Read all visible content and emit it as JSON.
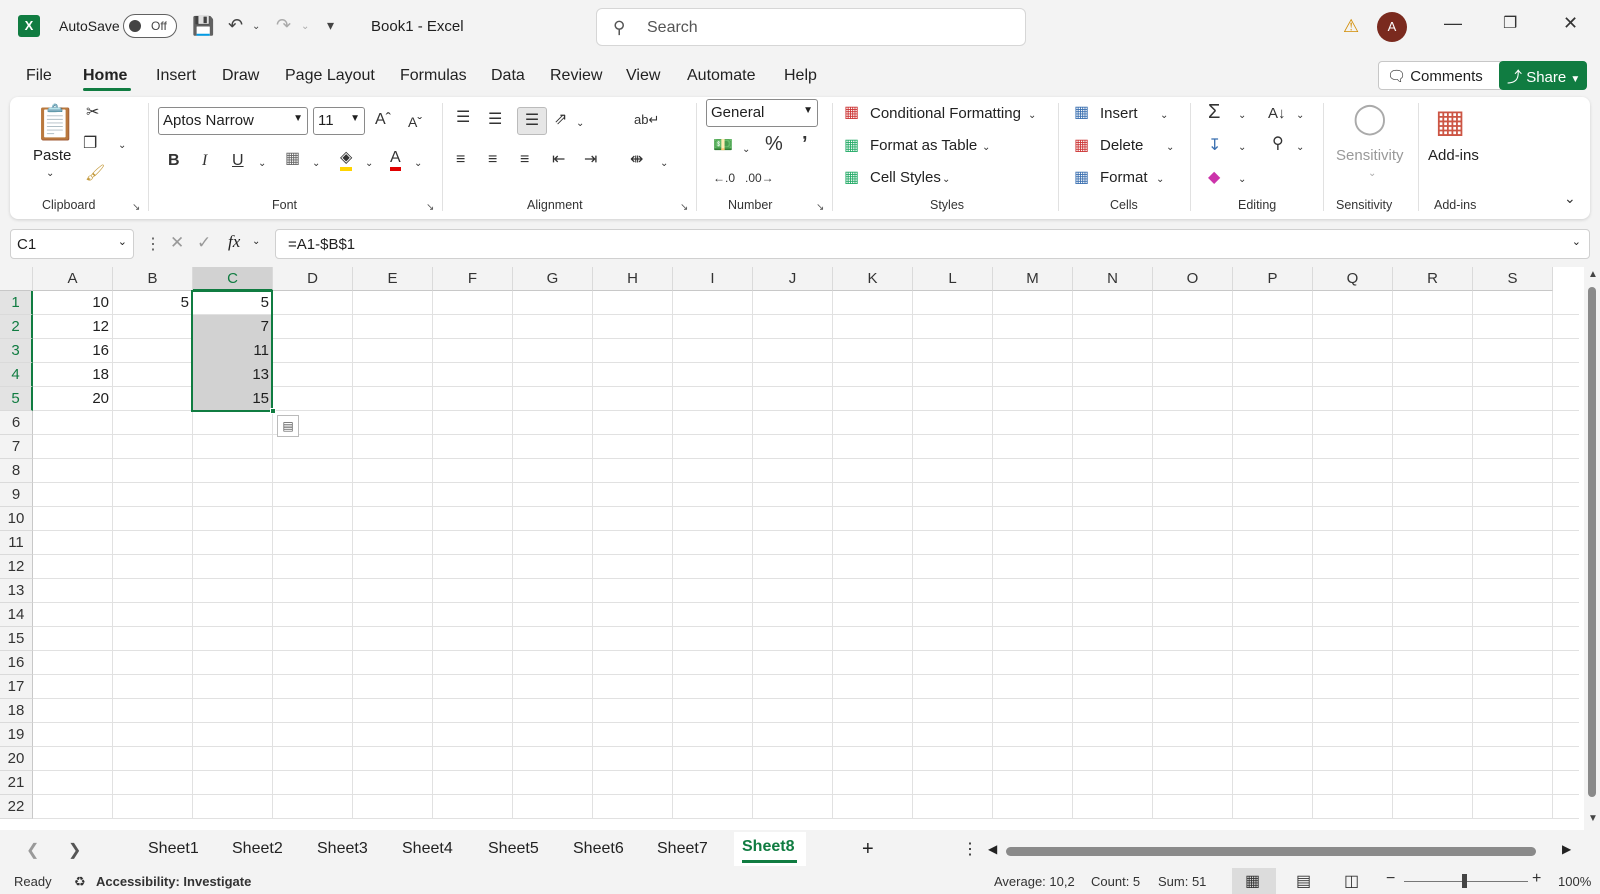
{
  "titlebar": {
    "app_icon": "X",
    "autosave_label": "AutoSave",
    "autosave_state": "Off",
    "doc_title": "Book1  -  Excel",
    "search_placeholder": "Search",
    "avatar_initial": "A"
  },
  "tabs": [
    "File",
    "Home",
    "Insert",
    "Draw",
    "Page Layout",
    "Formulas",
    "Data",
    "Review",
    "View",
    "Automate",
    "Help"
  ],
  "active_tab": "Home",
  "comments_label": "Comments",
  "share_label": "Share",
  "ribbon": {
    "clipboard": {
      "paste": "Paste",
      "label": "Clipboard"
    },
    "font": {
      "name": "Aptos Narrow",
      "size": "11",
      "label": "Font",
      "bold": "B",
      "italic": "I",
      "underline": "U"
    },
    "alignment": {
      "label": "Alignment"
    },
    "number": {
      "format": "General",
      "label": "Number",
      "percent": "%"
    },
    "styles": {
      "conditional": "Conditional Formatting",
      "format_table": "Format as Table",
      "cell_styles": "Cell Styles",
      "label": "Styles"
    },
    "cells": {
      "insert": "Insert",
      "delete": "Delete",
      "format": "Format",
      "label": "Cells"
    },
    "editing": {
      "label": "Editing"
    },
    "sensitivity": {
      "name": "Sensitivity",
      "label": "Sensitivity"
    },
    "addins": {
      "name": "Add-ins",
      "label": "Add-ins"
    }
  },
  "formula_bar": {
    "name_box": "C1",
    "formula": "=A1-$B$1"
  },
  "columns": [
    "A",
    "B",
    "C",
    "D",
    "E",
    "F",
    "G",
    "H",
    "I",
    "J",
    "K",
    "L",
    "M",
    "N",
    "O",
    "P",
    "Q",
    "R",
    "S"
  ],
  "rows": [
    "1",
    "2",
    "3",
    "4",
    "5",
    "6",
    "7",
    "8",
    "9",
    "10",
    "11",
    "12",
    "13",
    "14",
    "15",
    "16",
    "17",
    "18",
    "19",
    "20",
    "21",
    "22"
  ],
  "cells": {
    "A": [
      "10",
      "12",
      "16",
      "18",
      "20"
    ],
    "B": [
      "5"
    ],
    "C": [
      "5",
      "7",
      "11",
      "13",
      "15"
    ]
  },
  "sheets": [
    "Sheet1",
    "Sheet2",
    "Sheet3",
    "Sheet4",
    "Sheet5",
    "Sheet6",
    "Sheet7",
    "Sheet8"
  ],
  "active_sheet": "Sheet8",
  "status": {
    "ready": "Ready",
    "accessibility": "Accessibility: Investigate",
    "average": "Average: 10,2",
    "count": "Count: 5",
    "sum": "Sum: 51",
    "zoom": "100%"
  },
  "colors": {
    "accent": "#107c41",
    "selection": "#d2d2d2"
  }
}
